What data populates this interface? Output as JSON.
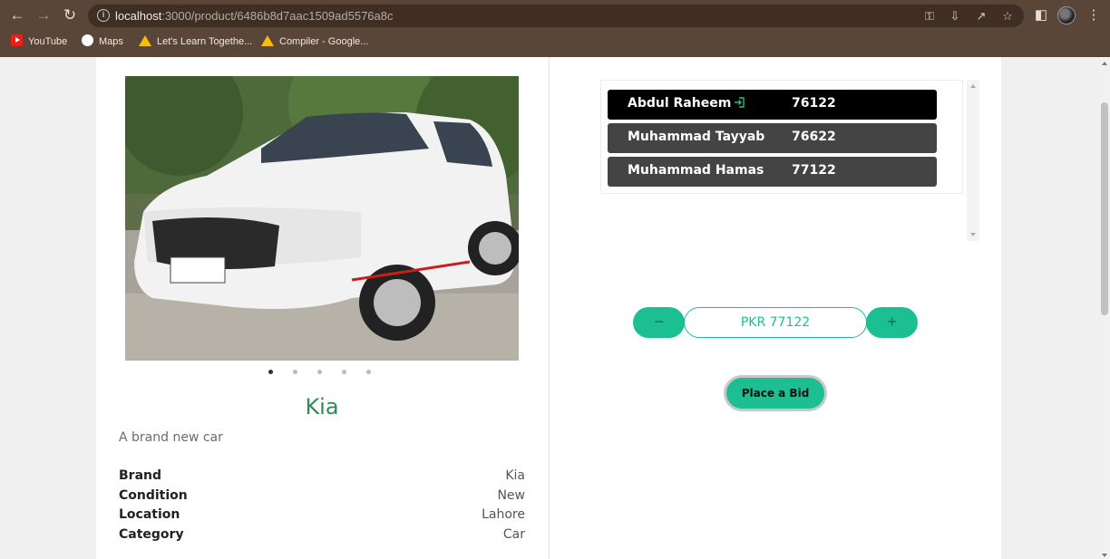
{
  "browser": {
    "url_host": "localhost",
    "url_rest": ":3000/product/6486b8d7aac1509ad5576a8c",
    "bookmarks": [
      {
        "label": "YouTube",
        "icon": "youtube-icon"
      },
      {
        "label": "Maps",
        "icon": "maps-icon"
      },
      {
        "label": "Let's Learn Togethe...",
        "icon": "drive-icon"
      },
      {
        "label": "Compiler - Google...",
        "icon": "drive-icon"
      }
    ]
  },
  "product": {
    "title": "Kia",
    "description": "A brand new car",
    "carousel": {
      "slide_count": 5,
      "active_index": 0
    },
    "specs": [
      {
        "key": "Brand",
        "value": "Kia"
      },
      {
        "key": "Condition",
        "value": "New"
      },
      {
        "key": "Location",
        "value": "Lahore"
      },
      {
        "key": "Category",
        "value": "Car"
      }
    ]
  },
  "bids": [
    {
      "name": "Abdul Raheem",
      "amount": "76122",
      "current_user": true
    },
    {
      "name": "Muhammad Tayyab",
      "amount": "76622",
      "current_user": false
    },
    {
      "name": "Muhammad Hamas",
      "amount": "77122",
      "current_user": false
    }
  ],
  "bid_form": {
    "minus_label": "−",
    "amount": "PKR 77122",
    "plus_label": "+",
    "submit_label": "Place a Bid"
  },
  "colors": {
    "accent": "#1bbf91",
    "title": "#2e8a57",
    "chrome": "#5a4638"
  }
}
